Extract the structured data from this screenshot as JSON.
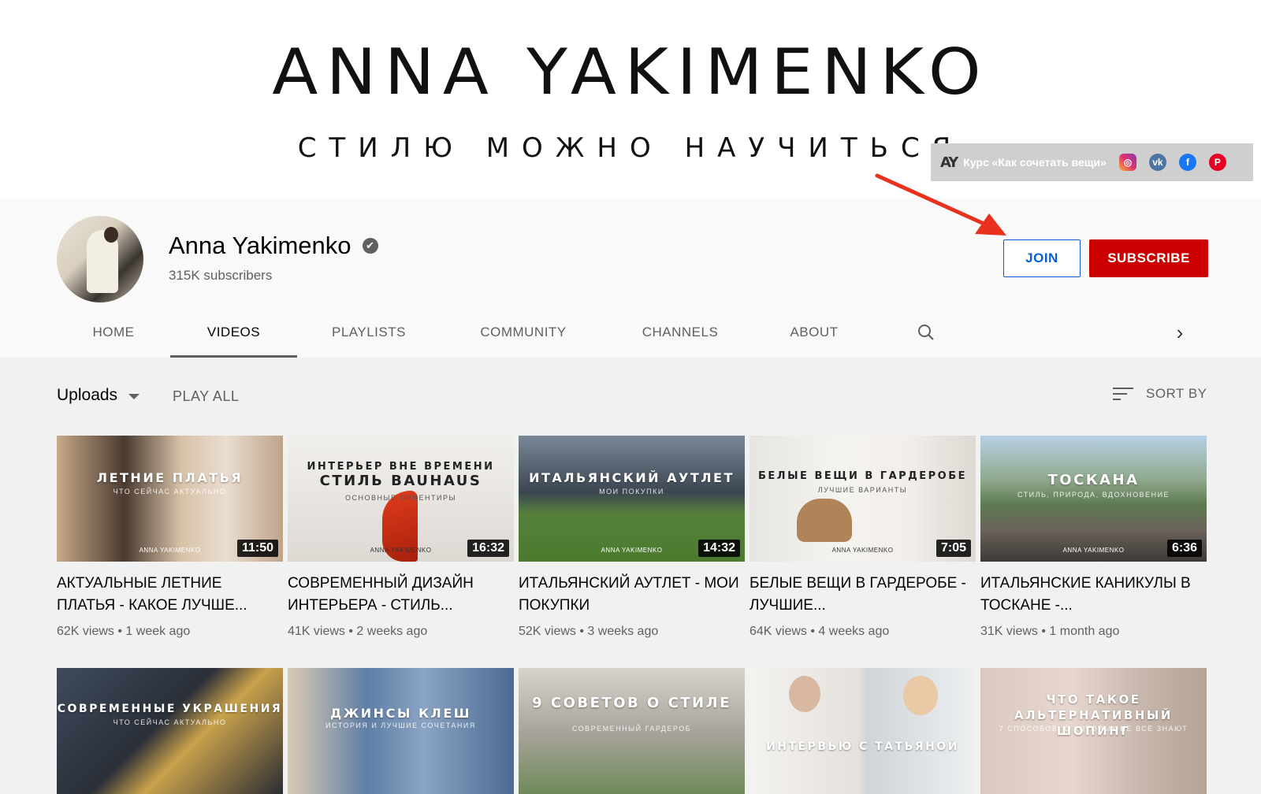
{
  "banner": {
    "title": "ANNA YAKIMENKO",
    "subtitle": "СТИЛЮ МОЖНО НАУЧИТЬСЯ",
    "links_logo": "AY",
    "links_text": "Курс «Как сочетать вещи»",
    "socials": [
      {
        "icon": "instagram-icon",
        "glyph": "◎"
      },
      {
        "icon": "vk-icon",
        "glyph": "vk"
      },
      {
        "icon": "facebook-icon",
        "glyph": "f"
      },
      {
        "icon": "pinterest-icon",
        "glyph": "P"
      }
    ]
  },
  "channel": {
    "name": "Anna Yakimenko",
    "verified_glyph": "✔",
    "subscribers": "315K subscribers",
    "join_label": "JOIN",
    "subscribe_label": "SUBSCRIBE"
  },
  "tabs": [
    {
      "label": "HOME",
      "active": false
    },
    {
      "label": "VIDEOS",
      "active": true
    },
    {
      "label": "PLAYLISTS",
      "active": false
    },
    {
      "label": "COMMUNITY",
      "active": false
    },
    {
      "label": "CHANNELS",
      "active": false
    },
    {
      "label": "ABOUT",
      "active": false
    }
  ],
  "tab_next_glyph": "›",
  "controls": {
    "uploads_label": "Uploads",
    "play_all_label": "PLAY ALL",
    "sort_by_label": "SORT BY"
  },
  "colors": {
    "subscribe_red": "#cc0000",
    "join_blue": "#065fd4",
    "arrow_red": "#e8321e"
  },
  "videos": [
    {
      "thumb_title": "ЛЕТНИЕ ПЛАТЬЯ",
      "thumb_sub": "ЧТО СЕЙЧАС АКТУАЛЬНО",
      "thumb_brand": "ANNA YAKIMENKO",
      "duration": "11:50",
      "title": "АКТУАЛЬНЫЕ ЛЕТНИЕ ПЛАТЬЯ - КАКОЕ ЛУЧШЕ...",
      "meta": "62K views • 1 week ago"
    },
    {
      "thumb_title": "ИНТЕРЬЕР ВНЕ ВРЕМЕНИ СТИЛЬ BAUHAUS",
      "thumb_sub": "ОСНОВНЫЕ ОРИЕНТИРЫ",
      "thumb_brand": "ANNA YAKIMENKO",
      "duration": "16:32",
      "title": "СОВРЕМЕННЫЙ ДИЗАЙН ИНТЕРЬЕРА - СТИЛЬ...",
      "meta": "41K views • 2 weeks ago"
    },
    {
      "thumb_title": "ИТАЛЬЯНСКИЙ АУТЛЕТ",
      "thumb_sub": "МОИ ПОКУПКИ",
      "thumb_brand": "ANNA YAKIMENKO",
      "duration": "14:32",
      "title": "ИТАЛЬЯНСКИЙ АУТЛЕТ - МОИ ПОКУПКИ",
      "meta": "52K views • 3 weeks ago"
    },
    {
      "thumb_title": "БЕЛЫЕ ВЕЩИ В ГАРДЕРОБЕ",
      "thumb_sub": "ЛУЧШИЕ ВАРИАНТЫ",
      "thumb_brand": "ANNA YAKIMENKO",
      "duration": "7:05",
      "title": "БЕЛЫЕ ВЕЩИ В ГАРДЕРОБЕ - ЛУЧШИЕ...",
      "meta": "64K views • 4 weeks ago"
    },
    {
      "thumb_title": "ТОСКАНА",
      "thumb_sub": "СТИЛЬ, ПРИРОДА, ВДОХНОВЕНИЕ",
      "thumb_brand": "ANNA YAKIMENKO",
      "duration": "6:36",
      "title": "ИТАЛЬЯНСКИЕ КАНИКУЛЫ В ТОСКАНЕ -...",
      "meta": "31K views • 1 month ago"
    }
  ],
  "videos_row2": [
    {
      "thumb_title": "СОВРЕМЕННЫЕ УКРАШЕНИЯ",
      "thumb_sub": "ЧТО СЕЙЧАС АКТУАЛЬНО"
    },
    {
      "thumb_title": "ДЖИНСЫ КЛЕШ",
      "thumb_sub": "ИСТОРИЯ И ЛУЧШИЕ СОЧЕТАНИЯ"
    },
    {
      "thumb_title": "9 СОВЕТОВ О СТИЛЕ",
      "thumb_sub": "СОВРЕМЕННЫЙ ГАРДЕРОБ"
    },
    {
      "thumb_title": "ИНТЕРВЬЮ С ТАТЬЯНОЙ",
      "thumb_sub": ""
    },
    {
      "thumb_title": "ЧТО ТАКОЕ АЛЬТЕРНАТИВНЫЙ ШОПИНГ",
      "thumb_sub": "7 СПОСОБОВ, О КОТОРЫХ НЕ ВСЕ ЗНАЮТ"
    }
  ]
}
